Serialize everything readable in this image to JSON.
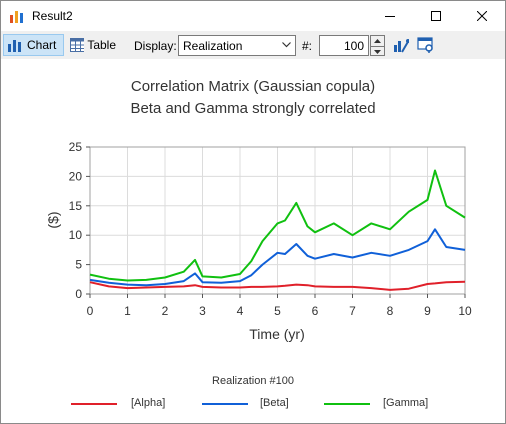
{
  "window": {
    "title": "Result2"
  },
  "toolbar": {
    "chart_label": "Chart",
    "table_label": "Table",
    "display_label": "Display:",
    "display_value": "Realization",
    "count_label": "#:",
    "count_value": "100"
  },
  "colors": {
    "alpha": "#e0202a",
    "beta": "#1060d8",
    "gamma": "#10c010"
  },
  "chart_data": {
    "type": "line",
    "title": "Correlation Matrix (Gaussian copula)",
    "subtitle": "Beta and Gamma strongly correlated",
    "xlabel": "Time (yr)",
    "ylabel": "($)",
    "xlim": [
      0,
      10
    ],
    "ylim": [
      0,
      25
    ],
    "x_ticks": [
      "0",
      "1",
      "2",
      "3",
      "4",
      "5",
      "6",
      "7",
      "8",
      "9",
      "10"
    ],
    "y_ticks": [
      "0",
      "5",
      "10",
      "15",
      "20",
      "25"
    ],
    "grid": true,
    "legend_title": "Realization #100",
    "legend_position": "bottom",
    "x": [
      0,
      0.5,
      1,
      1.5,
      2,
      2.5,
      2.8,
      3,
      3.5,
      4,
      4.3,
      4.6,
      5,
      5.2,
      5.5,
      5.8,
      6,
      6.5,
      7,
      7.5,
      8,
      8.5,
      9,
      9.2,
      9.5,
      10
    ],
    "series": [
      {
        "name": "[Alpha]",
        "values": [
          2.0,
          1.3,
          1.0,
          1.1,
          1.2,
          1.3,
          1.5,
          1.2,
          1.1,
          1.1,
          1.2,
          1.2,
          1.3,
          1.4,
          1.6,
          1.5,
          1.3,
          1.2,
          1.2,
          1.0,
          0.7,
          0.9,
          1.7,
          1.8,
          2.0,
          2.1
        ]
      },
      {
        "name": "[Beta]",
        "values": [
          2.4,
          1.9,
          1.6,
          1.5,
          1.7,
          2.2,
          3.5,
          2.0,
          1.9,
          2.2,
          3.2,
          5.0,
          7.0,
          6.8,
          8.5,
          6.5,
          6.0,
          6.8,
          6.2,
          7.0,
          6.5,
          7.5,
          9.0,
          11.0,
          8.0,
          7.5
        ]
      },
      {
        "name": "[Gamma]",
        "values": [
          3.3,
          2.6,
          2.3,
          2.4,
          2.8,
          3.8,
          5.8,
          3.0,
          2.8,
          3.4,
          5.6,
          9.0,
          12.0,
          12.5,
          15.5,
          11.5,
          10.5,
          12.0,
          10.0,
          12.0,
          11.0,
          14.0,
          16.0,
          21.0,
          15.0,
          13.0
        ]
      }
    ]
  }
}
